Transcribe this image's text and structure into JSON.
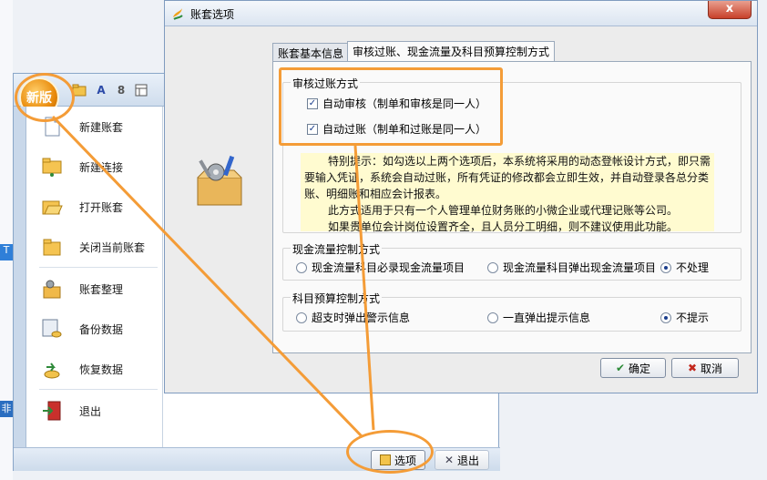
{
  "background": {
    "left_tags": [
      "T",
      "非"
    ]
  },
  "app": {
    "logo_text": "新版",
    "toolbar_icons": [
      "folder-icon",
      "font-icon",
      "number-icon",
      "table-icon"
    ],
    "menu_items": [
      {
        "label": "新建账套",
        "icon": "new-document-icon"
      },
      {
        "label": "新建连接",
        "icon": "network-folder-icon"
      },
      {
        "label": "打开账套",
        "icon": "open-folder-icon"
      },
      {
        "label": "关闭当前账套",
        "icon": "close-folder-icon"
      },
      {
        "label": "账套整理",
        "icon": "tools-icon"
      },
      {
        "label": "备份数据",
        "icon": "backup-icon"
      },
      {
        "label": "恢复数据",
        "icon": "restore-icon"
      },
      {
        "label": "退出",
        "icon": "exit-icon"
      }
    ],
    "bottom": {
      "options_label": "选项",
      "exit_label": "退出"
    }
  },
  "dialog": {
    "title": "账套选项",
    "close_label": "x",
    "tabs": [
      "账套基本信息",
      "审核过账、现金流量及科目预算控制方式"
    ],
    "audit_group": {
      "title": "审核过账方式",
      "options": [
        {
          "label": "自动审核（制单和审核是同一人）",
          "checked": true
        },
        {
          "label": "自动过账（制单和过账是同一人）",
          "checked": true
        }
      ]
    },
    "hint_lines": [
      "特别提示：如勾选以上两个选项后，本系统将采用的动态登帐设计方式，即只需",
      "要输入凭证，系统会自动过账，所有凭证的修改都会立即生效，并自动登录各总分类",
      "账、明细账和相应会计报表。",
      "此方式适用于只有一个人管理单位财务账的小微企业或代理记账等公司。",
      "如果贵单位会计岗位设置齐全，且人员分工明细，则不建议使用此功能。"
    ],
    "cash_group": {
      "title": "现金流量控制方式",
      "options": [
        {
          "label": "现金流量科目必录现金流量项目",
          "selected": false
        },
        {
          "label": "现金流量科目弹出现金流量项目",
          "selected": false
        },
        {
          "label": "不处理",
          "selected": true
        }
      ]
    },
    "budget_group": {
      "title": "科目预算控制方式",
      "options": [
        {
          "label": "超支时弹出警示信息",
          "selected": false
        },
        {
          "label": "一直弹出提示信息",
          "selected": false
        },
        {
          "label": "不提示",
          "selected": true
        }
      ]
    },
    "ok_label": "确定",
    "cancel_label": "取消"
  },
  "colors": {
    "highlight": "#f49c37",
    "hint_bg": "#fffbd0"
  }
}
